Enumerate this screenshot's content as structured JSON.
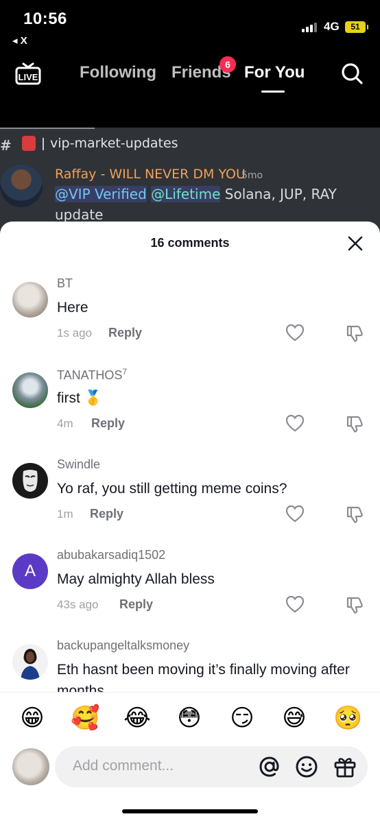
{
  "status_bar": {
    "time": "10:56",
    "back_app": "X",
    "network": "4G",
    "battery": "51"
  },
  "top_nav": {
    "tabs": [
      {
        "label": "Following"
      },
      {
        "label": "Friends",
        "badge": "6"
      },
      {
        "label": "For You"
      }
    ]
  },
  "video": {
    "channel": "vip-market-updates",
    "author": "Raffay - WILL NEVER DM YOU",
    "time": "5mo",
    "mention1": "@VIP Verified",
    "mention2": "@Lifetime",
    "message": " Solana, JUP, RAY update"
  },
  "comments_panel": {
    "title": "16 comments",
    "comments": [
      {
        "user": "BT",
        "text": "Here",
        "time": "1s ago",
        "reply": "Reply"
      },
      {
        "user": "TANATHOS",
        "user_sup": "7",
        "text": "first 🥇",
        "time": "4m",
        "reply": "Reply"
      },
      {
        "user": "Swindle",
        "text": "Yo raf, you still getting meme coins?",
        "time": "1m",
        "reply": "Reply"
      },
      {
        "user": "abubakarsadiq1502",
        "avatar_letter": "A",
        "text": "May almighty Allah bless",
        "time": "43s ago",
        "reply": "Reply"
      },
      {
        "user": "backupangeltalksmoney",
        "text": "Eth hasnt been moving it’s finally moving after months"
      }
    ]
  },
  "emoji_bar": [
    "😁",
    "🥰",
    "😂",
    "😳",
    "😏",
    "😅",
    "🥺"
  ],
  "comment_input": {
    "placeholder": "Add comment..."
  },
  "colors": {
    "accent": "#fe2c55",
    "avatar_letter_bg": "#5b3bc6"
  }
}
